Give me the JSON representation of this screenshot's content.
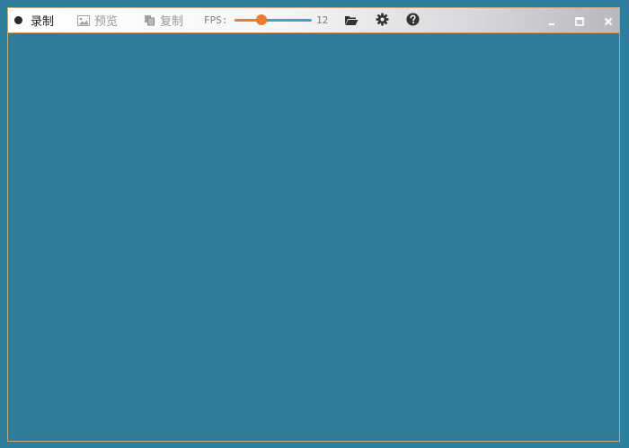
{
  "toolbar": {
    "record_label": "录制",
    "preview_label": "预览",
    "copy_label": "复制",
    "fps_label": "FPS:",
    "fps_value": "12",
    "fps_slider_fraction": 0.35,
    "icons": {
      "record": "record-dot-icon",
      "preview": "image-icon",
      "copy": "copy-icon",
      "folder": "folder-open-icon",
      "settings": "gear-icon",
      "help": "help-icon"
    }
  },
  "window_controls": {
    "icons": [
      "minimize-icon",
      "maximize-icon",
      "close-icon"
    ]
  },
  "colors": {
    "capture_area": "#2d7d9b",
    "accent_orange": "#f07a2b",
    "slider_track": "#3aa3d0",
    "frame_border": "#c8a57a"
  }
}
